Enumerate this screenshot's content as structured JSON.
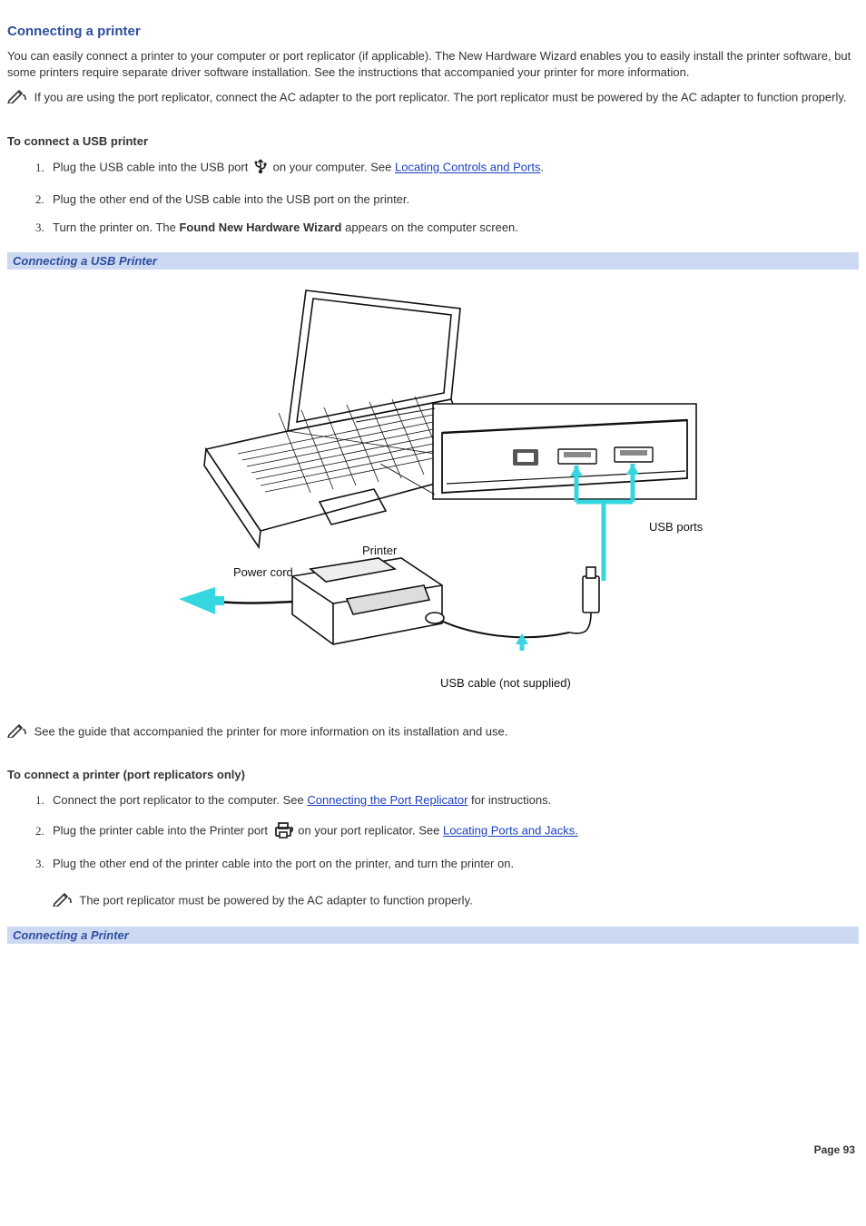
{
  "heading": "Connecting a printer",
  "intro_para": "You can easily connect a printer to your computer or port replicator (if applicable). The New Hardware Wizard enables you to easily install the printer software, but some printers require separate driver software installation. See the instructions that accompanied your printer for more information.",
  "note_1": "If you are using the port replicator, connect the AC adapter to the port replicator. The port replicator must be powered by the AC adapter to function properly.",
  "sub_heading_1": "To connect a USB printer",
  "step1_a": "Plug the USB cable into the USB port ",
  "step1_b": "on your computer. See ",
  "step1_link": "Locating Controls and Ports",
  "step1_c": ".",
  "step2": "Plug the other end of the USB cable into the USB port on the printer.",
  "step3_a": "Turn the printer on. The ",
  "step3_bold": "Found New Hardware Wizard",
  "step3_b": " appears on the computer screen.",
  "caption_1": "Connecting a USB Printer",
  "fig1_labels": {
    "usb_ports": "USB ports",
    "printer": "Printer",
    "power_cord": "Power cord",
    "usb_cable": "USB cable (not supplied)"
  },
  "note_2": "See the guide that accompanied the printer for more information on its installation and use.",
  "sub_heading_2": "To connect a printer (port replicators only)",
  "b_step1_a": "Connect the port replicator to the computer. See ",
  "b_step1_link": "Connecting the Port Replicator",
  "b_step1_b": " for instructions.",
  "b_step2_a": "Plug the printer cable into the Printer port ",
  "b_step2_b": " on your port replicator. See ",
  "b_step2_link": "Locating Ports and Jacks.",
  "b_step3": "Plug the other end of the printer cable into the port on the printer, and turn the printer on.",
  "note_3": "The port replicator must be powered by the AC adapter to function properly.",
  "caption_2": "Connecting a Printer",
  "page_number": "Page 93"
}
